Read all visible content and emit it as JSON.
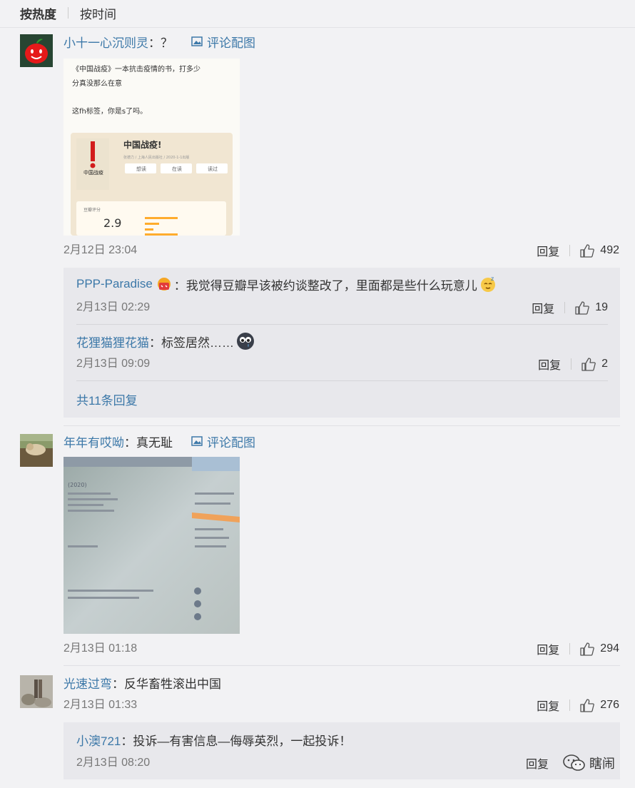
{
  "sort": {
    "hot": "按热度",
    "time": "按时间"
  },
  "comments": [
    {
      "user": "小十一心沉则灵",
      "text": "：？",
      "pic_label": "评论配图",
      "time": "2月12日 23:04",
      "reply": "回复",
      "likes": "492",
      "image": {
        "line1": "《中国战疫》一本抗击疫情的书，打多少",
        "line2": "分真没那么在意",
        "line3": "这fh标签，你是s了吗。",
        "book_title": "中国战疫!",
        "book_meta": "张德力 / 上海人民出版社 / 2020-1-1出版",
        "btn1": "想读",
        "btn2": "在读",
        "btn3": "读过",
        "rating_label": "豆瓣评分",
        "score": "2.9"
      },
      "replies": [
        {
          "user": "PPP-Paradise",
          "text": "：我觉得豆瓣早该被约谈整改了，里面都是些什么玩意儿",
          "time": "2月13日 02:29",
          "reply": "回复",
          "likes": "19"
        },
        {
          "user": "花狸猫狸花猫",
          "text": "：标签居然……",
          "time": "2月13日 09:09",
          "reply": "回复",
          "likes": "2"
        }
      ],
      "more": "共11条回复"
    },
    {
      "user": "年年有哎呦",
      "text": "：真无耻",
      "pic_label": "评论配图",
      "time": "2月13日 01:18",
      "reply": "回复",
      "likes": "294",
      "image": {
        "year": "(2020)"
      }
    },
    {
      "user": "光速过弯",
      "text": "：反华畜牲滚出中国",
      "time": "2月13日 01:33",
      "reply": "回复",
      "likes": "276",
      "replies": [
        {
          "user": "小澳721",
          "text": "：投诉—有害信息—侮辱英烈，一起投诉！",
          "time": "2月13日 08:20",
          "reply": "回复"
        }
      ]
    }
  ],
  "watermark": "瞎闹"
}
